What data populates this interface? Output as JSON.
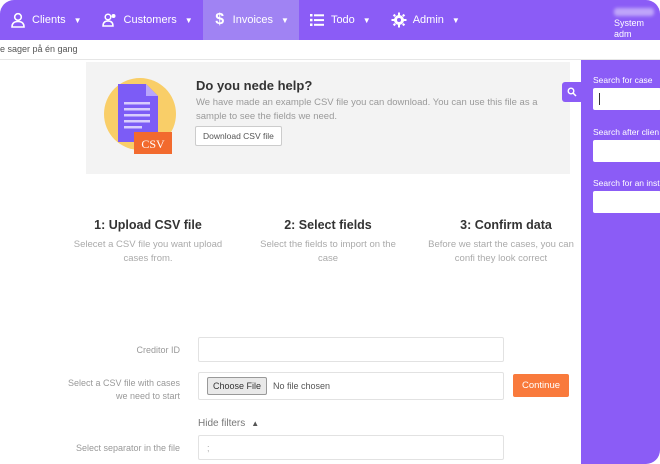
{
  "nav": {
    "items": [
      {
        "label": "Clients",
        "icon": "user-icon"
      },
      {
        "label": "Customers",
        "icon": "users-icon"
      },
      {
        "label": "Invoices",
        "icon": "dollar-icon"
      },
      {
        "label": "Todo",
        "icon": "list-icon"
      },
      {
        "label": "Admin",
        "icon": "gear-icon"
      }
    ],
    "active": "Invoices",
    "user_role": "System adm"
  },
  "subbar": {
    "text": "e sager på én gang"
  },
  "help": {
    "title": "Do you nede help?",
    "text": "We have made an example CSV file you can download. You can use this file as a sample to see the fields we need.",
    "button": "Download CSV file",
    "badge": "CSV"
  },
  "steps": [
    {
      "title": "1: Upload CSV file",
      "desc": "Selecet a CSV file you want upload cases from."
    },
    {
      "title": "2: Select fields",
      "desc": "Select the fields to import on the case"
    },
    {
      "title": "3: Confirm data",
      "desc": "Before we start the cases, you can confi they look correct"
    }
  ],
  "form": {
    "creditor_label": "Creditor ID",
    "creditor_value": "",
    "file_label": "Select a CSV file with cases we need to start",
    "choose_button": "Choose File",
    "file_status": "No file chosen",
    "continue_button": "Continue",
    "hide_filters": "Hide filters",
    "separator_label": "Select separator in the file",
    "separator_value": ";"
  },
  "search_panel": {
    "case_label": "Search for case",
    "client_label": "Search after clien",
    "instance_label": "Search for an insta"
  },
  "colors": {
    "brand": "#8b5cf6",
    "accent": "#f97a3c"
  }
}
